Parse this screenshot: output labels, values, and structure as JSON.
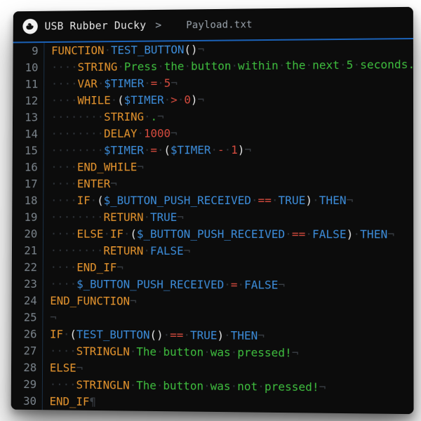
{
  "breadcrumb": {
    "root": "USB Rubber Ducky",
    "file": "Payload.txt"
  },
  "editor": {
    "first_line_no": 9,
    "lines": [
      {
        "indent": 0,
        "tokens": [
          [
            "kw",
            "FUNCTION"
          ],
          [
            "sp",
            " "
          ],
          [
            "ident",
            "TEST_BUTTON"
          ],
          [
            "paren",
            "()"
          ]
        ],
        "eol": "ret"
      },
      {
        "indent": 1,
        "tokens": [
          [
            "kw",
            "STRING"
          ],
          [
            "sp",
            " "
          ],
          [
            "txt",
            "Press the button within the next 5 seconds."
          ]
        ],
        "eol": "ret"
      },
      {
        "indent": 1,
        "tokens": [
          [
            "kw",
            "VAR"
          ],
          [
            "sp",
            " "
          ],
          [
            "ident",
            "$TIMER"
          ],
          [
            "sp",
            " "
          ],
          [
            "op",
            "="
          ],
          [
            "sp",
            " "
          ],
          [
            "num",
            "5"
          ]
        ],
        "eol": "ret"
      },
      {
        "indent": 1,
        "tokens": [
          [
            "kw",
            "WHILE"
          ],
          [
            "sp",
            " "
          ],
          [
            "paren",
            "("
          ],
          [
            "ident",
            "$TIMER"
          ],
          [
            "sp",
            " "
          ],
          [
            "op",
            ">"
          ],
          [
            "sp",
            " "
          ],
          [
            "num",
            "0"
          ],
          [
            "paren",
            ")"
          ]
        ],
        "eol": "ret"
      },
      {
        "indent": 2,
        "tokens": [
          [
            "kw",
            "STRING"
          ],
          [
            "sp",
            " "
          ],
          [
            "txt",
            "."
          ]
        ],
        "eol": "ret"
      },
      {
        "indent": 2,
        "tokens": [
          [
            "kw",
            "DELAY"
          ],
          [
            "sp",
            " "
          ],
          [
            "num",
            "1000"
          ]
        ],
        "eol": "ret"
      },
      {
        "indent": 2,
        "tokens": [
          [
            "ident",
            "$TIMER"
          ],
          [
            "sp",
            " "
          ],
          [
            "op",
            "="
          ],
          [
            "sp",
            " "
          ],
          [
            "paren",
            "("
          ],
          [
            "ident",
            "$TIMER"
          ],
          [
            "sp",
            " "
          ],
          [
            "op",
            "-"
          ],
          [
            "sp",
            " "
          ],
          [
            "num",
            "1"
          ],
          [
            "paren",
            ")"
          ]
        ],
        "eol": "ret"
      },
      {
        "indent": 1,
        "tokens": [
          [
            "kw",
            "END_WHILE"
          ]
        ],
        "eol": "ret"
      },
      {
        "indent": 1,
        "tokens": [
          [
            "kw",
            "ENTER"
          ]
        ],
        "eol": "ret"
      },
      {
        "indent": 1,
        "tokens": [
          [
            "kw",
            "IF"
          ],
          [
            "sp",
            " "
          ],
          [
            "paren",
            "("
          ],
          [
            "ident",
            "$_BUTTON_PUSH_RECEIVED"
          ],
          [
            "sp",
            " "
          ],
          [
            "op",
            "=="
          ],
          [
            "sp",
            " "
          ],
          [
            "kwblue",
            "TRUE"
          ],
          [
            "paren",
            ")"
          ],
          [
            "sp",
            " "
          ],
          [
            "kwblue",
            "THEN"
          ]
        ],
        "eol": "ret"
      },
      {
        "indent": 2,
        "tokens": [
          [
            "kw",
            "RETURN"
          ],
          [
            "sp",
            " "
          ],
          [
            "kwblue",
            "TRUE"
          ]
        ],
        "eol": "ret"
      },
      {
        "indent": 1,
        "tokens": [
          [
            "kw",
            "ELSE"
          ],
          [
            "sp",
            " "
          ],
          [
            "kw",
            "IF"
          ],
          [
            "sp",
            " "
          ],
          [
            "paren",
            "("
          ],
          [
            "ident",
            "$_BUTTON_PUSH_RECEIVED"
          ],
          [
            "sp",
            " "
          ],
          [
            "op",
            "=="
          ],
          [
            "sp",
            " "
          ],
          [
            "kwblue",
            "FALSE"
          ],
          [
            "paren",
            ")"
          ],
          [
            "sp",
            " "
          ],
          [
            "kwblue",
            "THEN"
          ]
        ],
        "eol": "ret"
      },
      {
        "indent": 2,
        "tokens": [
          [
            "kw",
            "RETURN"
          ],
          [
            "sp",
            " "
          ],
          [
            "kwblue",
            "FALSE"
          ]
        ],
        "eol": "ret"
      },
      {
        "indent": 1,
        "tokens": [
          [
            "kw",
            "END_IF"
          ]
        ],
        "eol": "ret"
      },
      {
        "indent": 1,
        "tokens": [
          [
            "ident",
            "$_BUTTON_PUSH_RECEIVED"
          ],
          [
            "sp",
            " "
          ],
          [
            "op",
            "="
          ],
          [
            "sp",
            " "
          ],
          [
            "kwblue",
            "FALSE"
          ]
        ],
        "eol": "ret"
      },
      {
        "indent": 0,
        "tokens": [
          [
            "kw",
            "END_FUNCTION"
          ]
        ],
        "eol": "ret"
      },
      {
        "indent": 0,
        "tokens": [],
        "eol": "ret"
      },
      {
        "indent": 0,
        "tokens": [
          [
            "kw",
            "IF"
          ],
          [
            "sp",
            " "
          ],
          [
            "paren",
            "("
          ],
          [
            "ident",
            "TEST_BUTTON"
          ],
          [
            "paren",
            "()"
          ],
          [
            "sp",
            " "
          ],
          [
            "op",
            "=="
          ],
          [
            "sp",
            " "
          ],
          [
            "kwblue",
            "TRUE"
          ],
          [
            "paren",
            ")"
          ],
          [
            "sp",
            " "
          ],
          [
            "kwblue",
            "THEN"
          ]
        ],
        "eol": "ret"
      },
      {
        "indent": 1,
        "tokens": [
          [
            "kw",
            "STRINGLN"
          ],
          [
            "sp",
            " "
          ],
          [
            "txt",
            "The button was pressed!"
          ]
        ],
        "eol": "ret"
      },
      {
        "indent": 0,
        "tokens": [
          [
            "kw",
            "ELSE"
          ]
        ],
        "eol": "ret"
      },
      {
        "indent": 1,
        "tokens": [
          [
            "kw",
            "STRINGLN"
          ],
          [
            "sp",
            " "
          ],
          [
            "txt",
            "The button was not pressed!"
          ]
        ],
        "eol": "ret"
      },
      {
        "indent": 0,
        "tokens": [
          [
            "kw",
            "END_IF"
          ]
        ],
        "eol": "pilcrow"
      }
    ]
  }
}
